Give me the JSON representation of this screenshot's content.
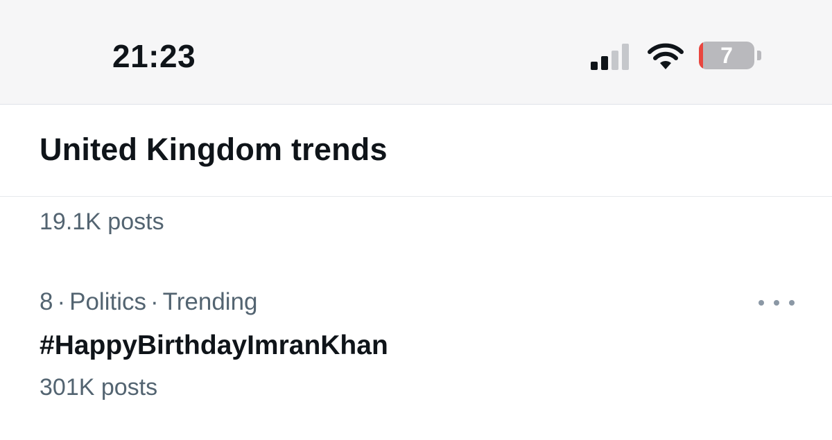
{
  "status_bar": {
    "time": "21:23",
    "battery_level": "7",
    "battery_fraction": 0.07,
    "signal_bars_active": 2,
    "signal_bars_total": 4,
    "signal_icon": "cellular-signal-icon",
    "wifi_icon": "wifi-icon",
    "battery_icon": "battery-icon"
  },
  "header": {
    "title": "United Kingdom trends"
  },
  "trends": {
    "previous": {
      "count": "19.1K posts"
    },
    "items": [
      {
        "rank": "8",
        "category": "Politics",
        "label": "Trending",
        "name": "#HappyBirthdayImranKhan",
        "count": "301K posts",
        "more_icon": "more-dots-icon"
      }
    ]
  },
  "colors": {
    "text_primary": "#0f1419",
    "text_secondary": "#536471",
    "battery_low": "#e9463f",
    "status_bar_bg": "#f6f6f7"
  }
}
